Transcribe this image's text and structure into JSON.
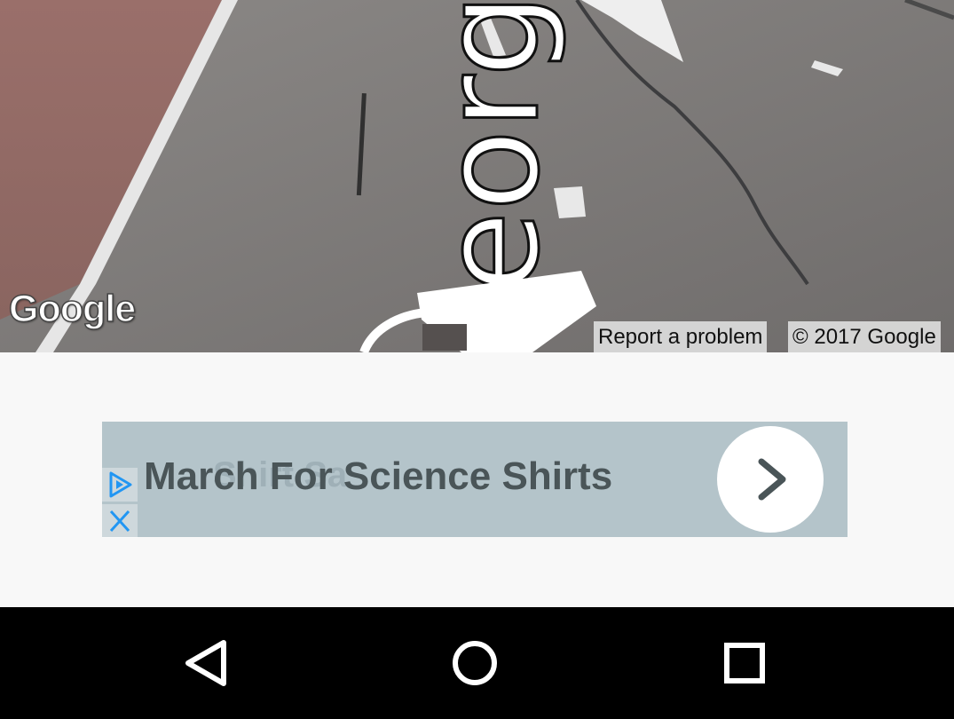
{
  "map": {
    "logo_text": "Google",
    "report_label": "Report a problem",
    "copyright": "© 2017 Google",
    "road_text": "George St"
  },
  "ad": {
    "title": "March For Science Shirts",
    "ghost_text": "Shirt Sa",
    "choices_icon": "ad-choices-icon",
    "close_icon": "close-icon",
    "cta_icon": "chevron-right-icon",
    "background": "#b4c4ca",
    "accent": "#2196f3"
  },
  "navbar": {
    "back_icon": "back-triangle-icon",
    "home_icon": "home-circle-icon",
    "recents_icon": "recents-square-icon"
  }
}
